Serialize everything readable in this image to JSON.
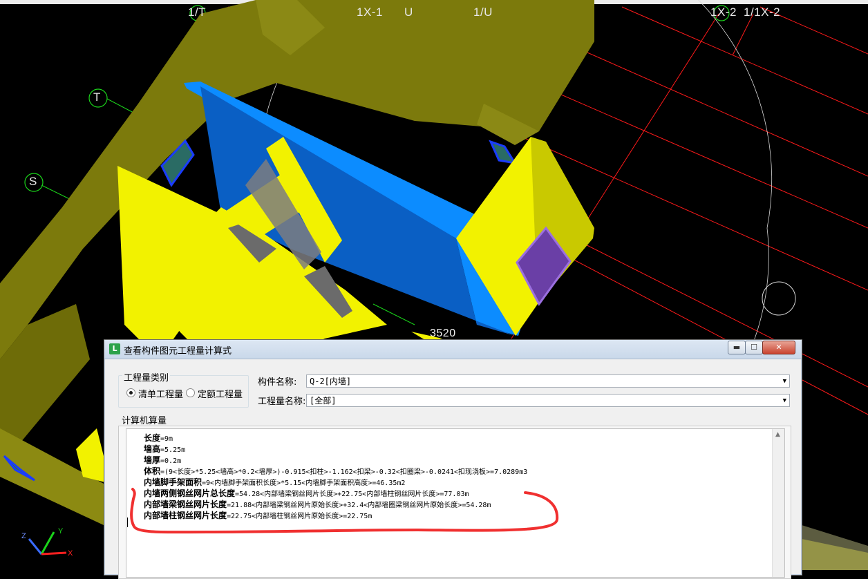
{
  "viewport": {
    "axis_labels": [
      "1/T",
      "1X-1",
      "U",
      "1/U",
      "1X-2",
      "1/1X-2",
      "T",
      "S"
    ],
    "dimension_text": "3520",
    "ucs_axes": [
      "Z",
      "Y",
      "X"
    ]
  },
  "dialog": {
    "title": "查看构件图元工程量计算式",
    "icon_glyph": "L",
    "minimize_glyph": "▬",
    "maximize_glyph": "☐",
    "close_glyph": "✕",
    "quantity_type": {
      "group_label": "工程量类别",
      "options": [
        {
          "label": "清单工程量",
          "selected": true
        },
        {
          "label": "定额工程量",
          "selected": false
        }
      ]
    },
    "component_name": {
      "label": "构件名称:",
      "value": "Q-2[内墙]"
    },
    "quantity_name": {
      "label": "工程量名称:",
      "value": "[全部]"
    },
    "calc_label": "计算机算量",
    "calc_lines": [
      {
        "name": "长度",
        "expr": "=9m"
      },
      {
        "name": "墙高",
        "expr": "=5.25m"
      },
      {
        "name": "墙厚",
        "expr": "=0.2m"
      },
      {
        "name": "体积",
        "expr": "=(9<长度>*5.25<墙高>*0.2<墙厚>)-0.915<扣柱>-1.162<扣梁>-0.32<扣圈梁>-0.0241<扣现浇板>=7.0289m3"
      },
      {
        "name": "内墙脚手架面积",
        "expr": "=9<内墙脚手架面积长度>*5.15<内墙脚手架面积高度>=46.35m2"
      },
      {
        "name": "内墙两侧钢丝网片总长度",
        "expr": "=54.28<内部墙梁钢丝网片长度>+22.75<内部墙柱钢丝网片长度>=77.03m"
      },
      {
        "name": "内部墙梁钢丝网片长度",
        "expr": "=21.88<内部墙梁钢丝网片原始长度>+32.4<内部墙圈梁钢丝网片原始长度>=54.28m"
      },
      {
        "name": "内部墙柱钢丝网片长度",
        "expr": "=22.75<内部墙柱钢丝网片原始长度>=22.75m"
      }
    ]
  },
  "colors": {
    "background": "#000000",
    "wall_olive": "#7c7a0c",
    "wall_yellow": "#f2f200",
    "selected_wall_blue": "#0a5fc4",
    "window_purple": "#6a3fa6",
    "grid_red": "#ff1a1a",
    "grid_green": "#1bd41b",
    "annotation_red": "#f03030"
  }
}
